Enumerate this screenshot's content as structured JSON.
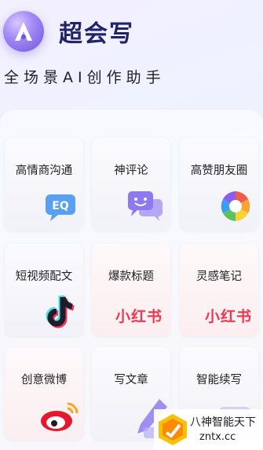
{
  "app": {
    "title": "超会写",
    "tagline": "全场景AI创作助手"
  },
  "cards": [
    {
      "label": "高情商沟通",
      "icon": "eq-chat-bubble-icon",
      "icon_text": "EQ"
    },
    {
      "label": "神评论",
      "icon": "comment-bubbles-icon"
    },
    {
      "label": "高赞朋友圈",
      "icon": "moments-aperture-icon"
    },
    {
      "label": "短视频配文",
      "icon": "tiktok-icon"
    },
    {
      "label": "爆款标题",
      "icon": "xiaohongshu-logo",
      "logo_text": "小红书"
    },
    {
      "label": "灵感笔记",
      "icon": "xiaohongshu-logo",
      "logo_text": "小红书"
    },
    {
      "label": "创意微博",
      "icon": "weibo-icon"
    },
    {
      "label": "写文章",
      "icon": "article-pen-icon"
    },
    {
      "label": "智能续写",
      "icon": "ai-continue-icon"
    }
  ],
  "watermark": {
    "line1": "八神智能天下",
    "line2": "zntx.cc"
  },
  "colors": {
    "title": "#23236a",
    "accent": "#7b63ee",
    "xiaohongshu": "#f0384f"
  }
}
